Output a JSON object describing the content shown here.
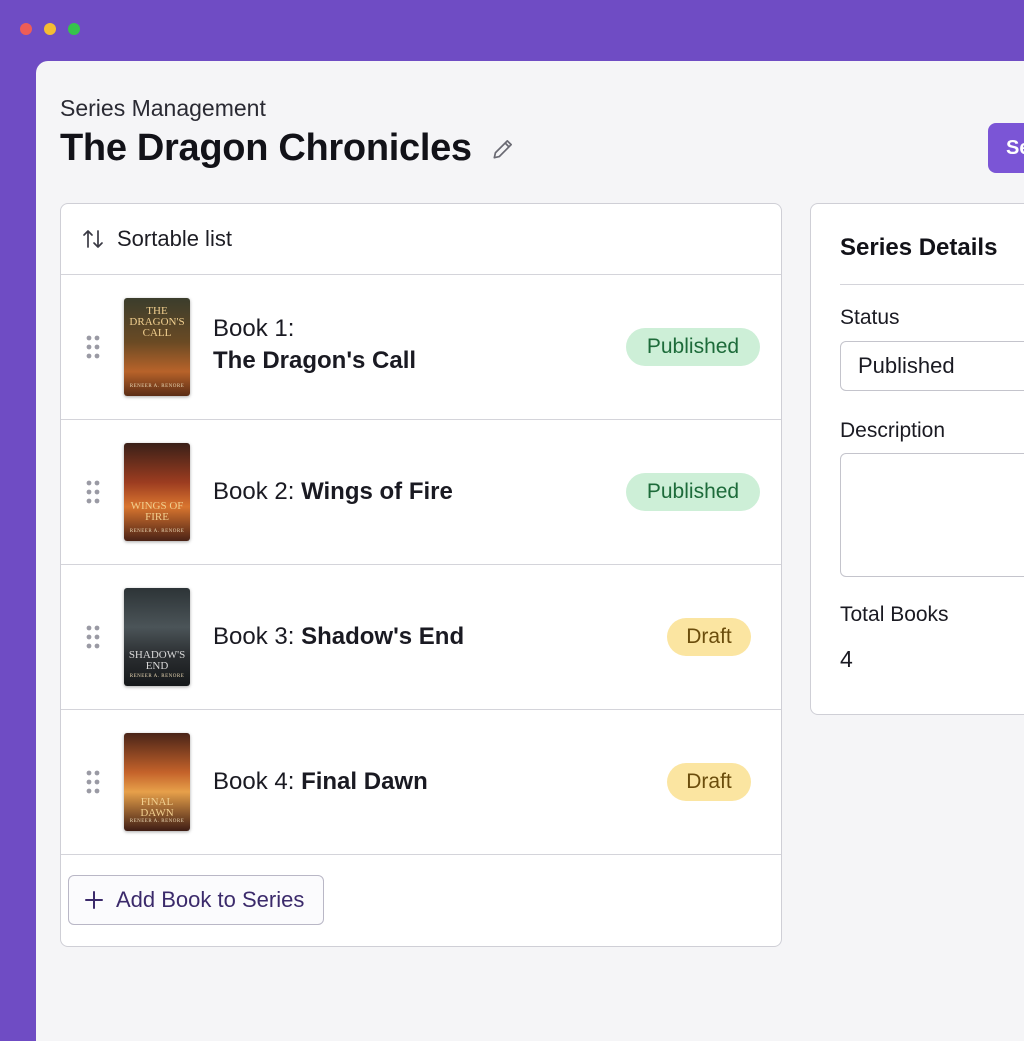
{
  "window": {
    "controls": [
      "close",
      "minimize",
      "maximize"
    ]
  },
  "header": {
    "breadcrumb": "Series Management",
    "title": "The Dragon Chronicles",
    "edit_icon": "pencil-icon",
    "save_label": "Se"
  },
  "list": {
    "header_label": "Sortable list",
    "header_icon": "sort-arrows-icon",
    "books": [
      {
        "prefix": "Book 1:",
        "name": "The Dragon's Call",
        "status": "Published",
        "cover_title": "THE DRAGON'S CALL",
        "cover_author": "RENEER A. RENORE"
      },
      {
        "prefix": "Book 2:",
        "name": "Wings of Fire",
        "status": "Published",
        "cover_title": "WINGS OF FIRE",
        "cover_author": "RENEER A. RENORE"
      },
      {
        "prefix": "Book 3:",
        "name": "Shadow's End",
        "status": "Draft",
        "cover_title": "SHADOW'S END",
        "cover_author": "RENEER A. RENORE"
      },
      {
        "prefix": "Book 4:",
        "name": "Final Dawn",
        "status": "Draft",
        "cover_title": "FINAL DAWN",
        "cover_author": "RENEER A. RENORE"
      }
    ],
    "add_label": "Add Book to Series"
  },
  "details": {
    "title": "Series Details",
    "status_label": "Status",
    "status_value": "Published",
    "description_label": "Description",
    "description_value": "",
    "total_label": "Total Books",
    "total_value": "4"
  },
  "colors": {
    "background": "#6f4cc4",
    "accent": "#7b55d6",
    "published_bg": "#cdefd7",
    "published_text": "#1d6b3a",
    "draft_bg": "#fbe5a1",
    "draft_text": "#6b4d0c"
  }
}
